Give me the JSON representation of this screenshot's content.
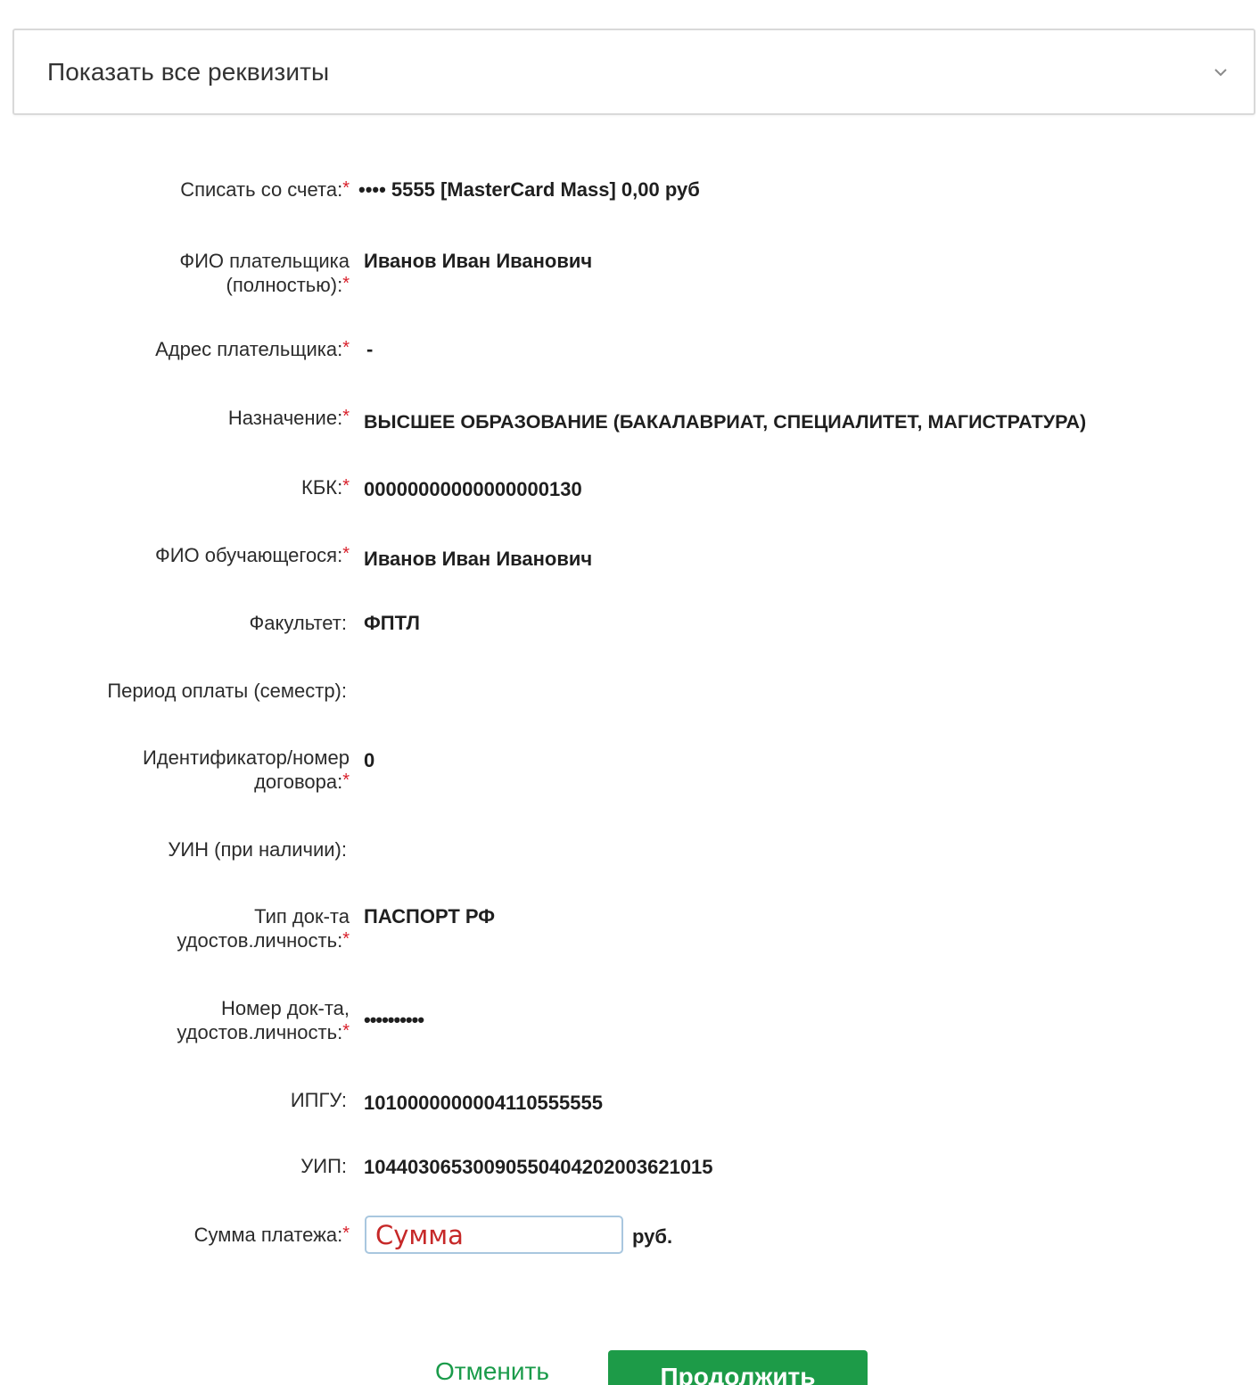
{
  "requisites": {
    "title": "Показать все реквизиты",
    "icon": "chevron-down-icon"
  },
  "required_marker": "*",
  "fields": {
    "account": {
      "label": "Списать со счета:",
      "value": "•••• 5555 [MasterCard Mass] 0,00 руб"
    },
    "payer_name": {
      "label_line1": "ФИО плательщика",
      "label_line2": "(полностью):",
      "value": "Иванов Иван Иванович"
    },
    "payer_address": {
      "label": "Адрес плательщика:",
      "value": "-"
    },
    "purpose": {
      "label": "Назначение:",
      "value": "ВЫСШЕЕ ОБРАЗОВАНИЕ (БАКАЛАВРИАТ, СПЕЦИАЛИТЕТ, МАГИСТРАТУРА)"
    },
    "kbk": {
      "label": "КБК:",
      "value": "00000000000000000130"
    },
    "student_name": {
      "label": "ФИО обучающегося:",
      "value": "Иванов Иван Иванович"
    },
    "faculty": {
      "label": "Факультет:",
      "value": "ФПТЛ"
    },
    "period": {
      "label": "Период оплаты (семестр):",
      "value": ""
    },
    "contract_id": {
      "label_line1": "Идентификатор/номер",
      "label_line2": "договора:",
      "value": "0"
    },
    "uin": {
      "label": "УИН (при наличии):",
      "value": ""
    },
    "doc_type": {
      "label_line1": "Тип док-та",
      "label_line2": "удостов.личность:",
      "value": "ПАСПОРТ РФ"
    },
    "doc_number": {
      "label_line1": "Номер док-та,",
      "label_line2": "удостов.личность:",
      "value": "••••••••••"
    },
    "ipgu": {
      "label": "ИПГУ:",
      "value": "1010000000004110555555"
    },
    "uip": {
      "label": "УИП:",
      "value": "10440306530090550404202003621015"
    },
    "amount": {
      "label": "Сумма платежа:",
      "placeholder": "Сумма",
      "currency": "руб."
    }
  },
  "buttons": {
    "cancel": "Отменить",
    "continue": "Продолжить"
  },
  "colors": {
    "accent_green": "#1d9b48",
    "required_red": "#d9202b",
    "placeholder_red": "#c62828"
  }
}
